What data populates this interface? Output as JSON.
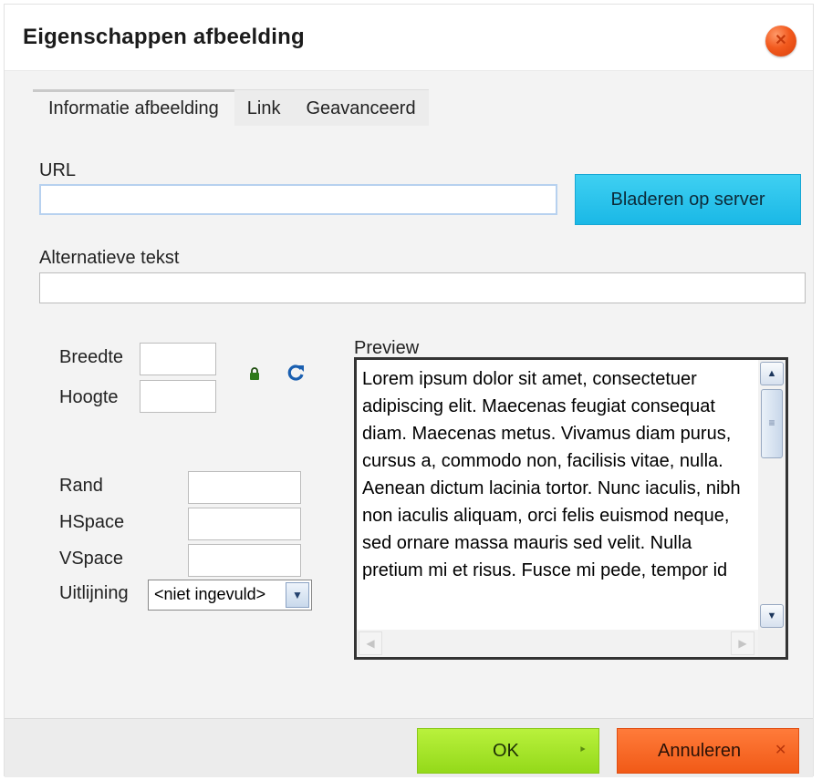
{
  "dialog": {
    "title": "Eigenschappen afbeelding",
    "close_icon": "close-icon"
  },
  "tabs": [
    {
      "label": "Informatie afbeelding",
      "active": true
    },
    {
      "label": "Link",
      "active": false
    },
    {
      "label": "Geavanceerd",
      "active": false
    }
  ],
  "form": {
    "url_label": "URL",
    "url_value": "",
    "browse_label": "Bladeren op server",
    "alt_label": "Alternatieve tekst",
    "alt_value": "",
    "width_label": "Breedte",
    "height_label": "Hoogte",
    "lock_icon": "lock-icon",
    "reset_icon": "reset-size-icon",
    "border_label": "Rand",
    "hspace_label": "HSpace",
    "vspace_label": "VSpace",
    "align_label": "Uitlijning",
    "align_value": "<niet ingevuld>"
  },
  "preview": {
    "label": "Preview",
    "text": "Lorem ipsum dolor sit amet, consectetuer adipiscing elit. Maecenas feugiat consequat diam. Maecenas metus. Vivamus diam purus, cursus a, commodo non, facilisis vitae, nulla. Aenean dictum lacinia tortor. Nunc iaculis, nibh non iaculis aliquam, orci felis euismod neque, sed ornare massa mauris sed velit. Nulla pretium mi et risus. Fusce mi pede, tempor id"
  },
  "footer": {
    "ok_label": "OK",
    "cancel_label": "Annuleren"
  },
  "colors": {
    "ok": "#9be021",
    "cancel": "#f4601f",
    "browse": "#22bee9",
    "close": "#f25a1e"
  }
}
